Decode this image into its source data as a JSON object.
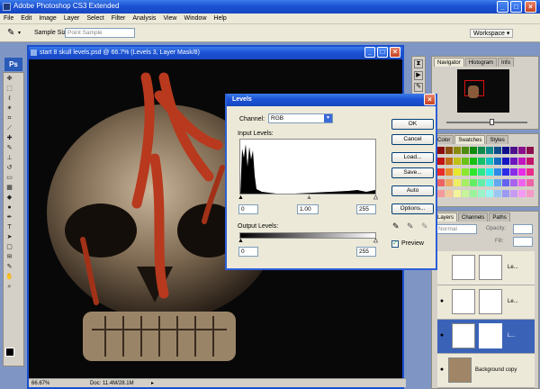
{
  "app": {
    "title": "Adobe Photoshop CS3 Extended",
    "logo": "Ps",
    "window_buttons": [
      "_",
      "□",
      "×"
    ]
  },
  "menu": [
    "File",
    "Edit",
    "Image",
    "Layer",
    "Select",
    "Filter",
    "Analysis",
    "View",
    "Window",
    "Help"
  ],
  "options_bar": {
    "sample_size_label": "Sample Size:",
    "sample_size_value": "Point Sample",
    "workspace_label": "Workspace"
  },
  "document": {
    "title": "start 8 skull levels.psd @ 66.7% (Levels 3, Layer Mask/8)",
    "zoom": "66.67%",
    "doc_info": "Doc: 11.4M/28.1M"
  },
  "levels_dialog": {
    "title": "Levels",
    "channel_label": "Channel:",
    "channel_value": "RGB",
    "input_levels_label": "Input Levels:",
    "input_black": "0",
    "input_gamma": "1.00",
    "input_white": "255",
    "output_levels_label": "Output Levels:",
    "output_black": "0",
    "output_white": "255",
    "buttons": {
      "ok": "OK",
      "cancel": "Cancel",
      "load": "Load...",
      "save": "Save...",
      "auto": "Auto",
      "options": "Options..."
    },
    "preview_label": "Preview",
    "preview_checked": true
  },
  "navigator": {
    "tabs": [
      "Navigator",
      "Histogram",
      "Info"
    ]
  },
  "swatches": {
    "tabs": [
      "Color",
      "Swatches",
      "Styles"
    ]
  },
  "layers": {
    "tabs": [
      "Layers",
      "Channels",
      "Paths"
    ],
    "blend_mode": "Normal",
    "opacity_label": "Opacity:",
    "fill_label": "Fill:",
    "items": [
      {
        "name": "Le...",
        "visible": false
      },
      {
        "name": "Le...",
        "visible": true
      },
      {
        "name": "L...",
        "visible": true,
        "selected": true
      },
      {
        "name": "Background copy",
        "visible": true
      }
    ]
  },
  "colors": {
    "titlebar": "#1b52d4",
    "accent": "#2c5ed8",
    "dialog_bg": "#ece9d8"
  }
}
